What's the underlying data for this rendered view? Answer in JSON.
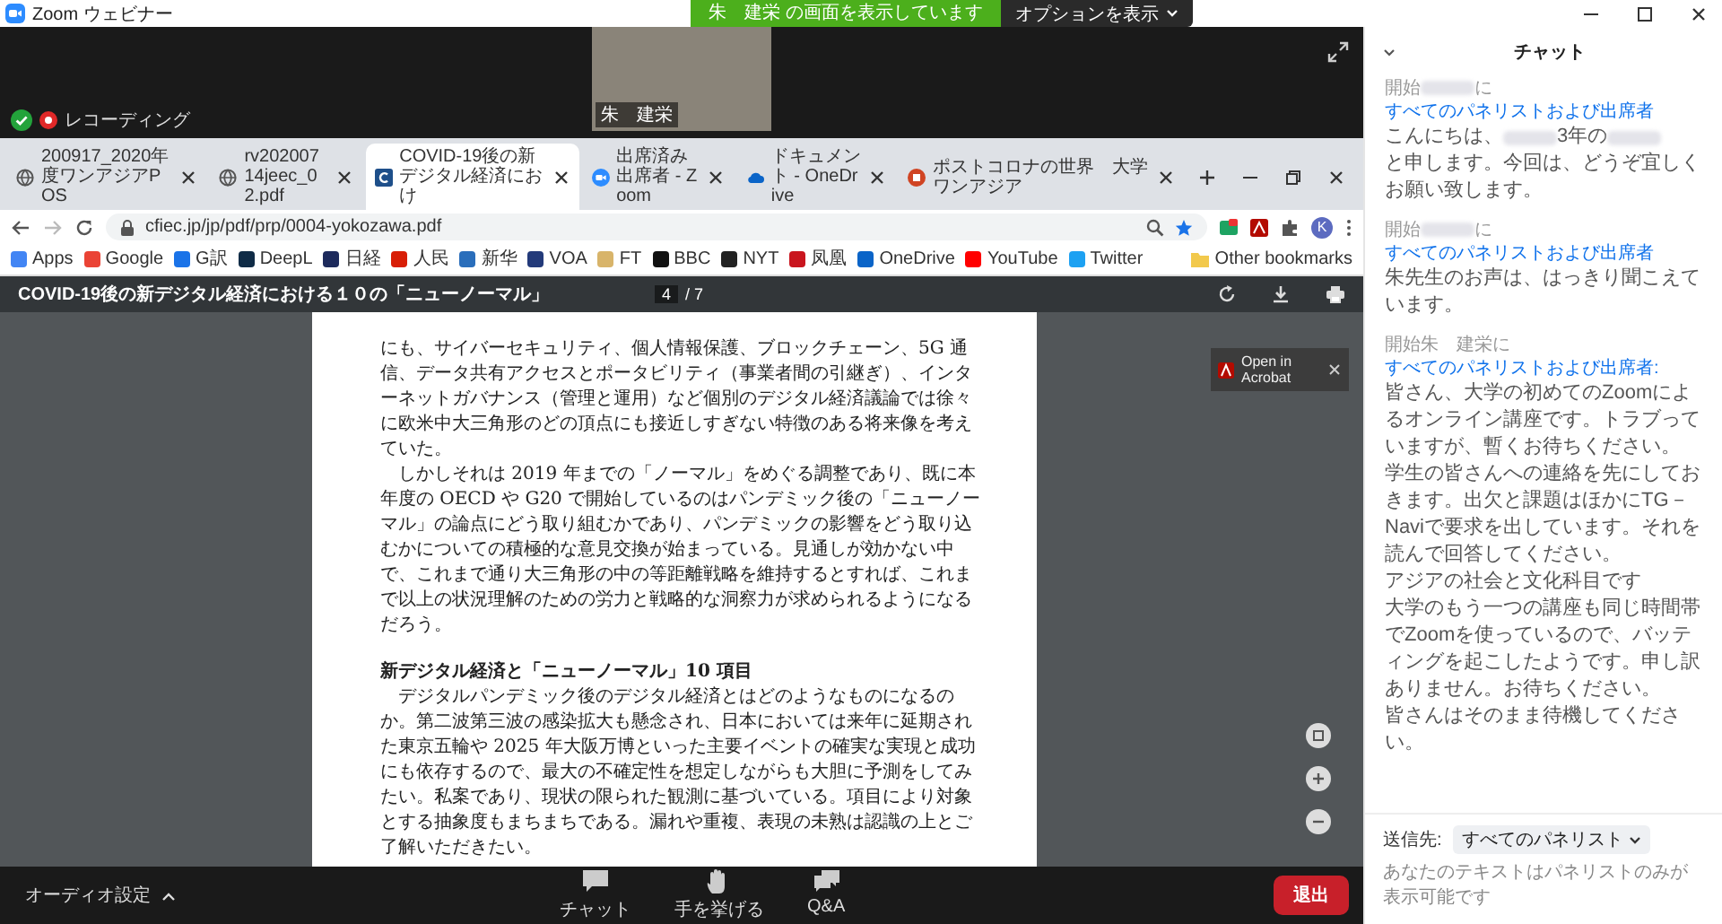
{
  "window": {
    "title": "Zoom ウェビナー"
  },
  "share_banner": {
    "status": "朱　建栄 の画面を表示しています",
    "options_button": "オプションを表示"
  },
  "video": {
    "name": "朱　建栄"
  },
  "recording": {
    "label": "レコーディング"
  },
  "browser": {
    "tabs": [
      {
        "title": "200917_2020年度ワンアジアPOS",
        "kind": "globe",
        "selected": false
      },
      {
        "title": "rv20200714jeec_02.pdf",
        "kind": "globe",
        "selected": false
      },
      {
        "title": "COVID-19後の新デジタル経済におけ",
        "kind": "doc",
        "selected": true
      },
      {
        "title": "出席済み出席者 - Zoom",
        "kind": "zoom",
        "selected": false
      },
      {
        "title": "ドキュメント - OneDrive",
        "kind": "cloud",
        "selected": false
      },
      {
        "title": "ポストコロナの世界　大学ワンアジア",
        "kind": "slides",
        "selected": false
      }
    ],
    "address": "cfiec.jp/jp/pdf/prp/0004-yokozawa.pdf",
    "profile_initial": "K",
    "bookmarks": [
      {
        "label": "Apps",
        "color": "#4285f4"
      },
      {
        "label": "Google",
        "color": "#ea4335"
      },
      {
        "label": "G訳",
        "color": "#1a73e8"
      },
      {
        "label": "DeepL",
        "color": "#0f2b46"
      },
      {
        "label": "日経",
        "color": "#1d2a5c"
      },
      {
        "label": "人民",
        "color": "#d81e06"
      },
      {
        "label": "新华",
        "color": "#2a6ebb"
      },
      {
        "label": "VOA",
        "color": "#233a7a"
      },
      {
        "label": "FT",
        "color": "#d8b46a"
      },
      {
        "label": "BBC",
        "color": "#111111"
      },
      {
        "label": "NYT",
        "color": "#222222"
      },
      {
        "label": "凤凰",
        "color": "#c9151e"
      },
      {
        "label": "OneDrive",
        "color": "#0a64c8"
      },
      {
        "label": "YouTube",
        "color": "#ff0000"
      },
      {
        "label": "Twitter",
        "color": "#1da1f2"
      }
    ],
    "other_bookmarks": "Other bookmarks"
  },
  "pdf": {
    "title": "COVID-19後の新デジタル経済における１０の「ニューノーマル」",
    "page": "4",
    "page_total": "/ 7",
    "paragraphs": [
      {
        "kind": "text",
        "indent": false,
        "text": "にも、サイバーセキュリティ、個人情報保護、ブロックチェーン、5G 通信、データ共有アクセスとポータビリティ（事業者間の引継ぎ）、インターネットガバナンス（管理と運用）など個別のデジタル経済議論では徐々に欧米中大三角形のどの頂点にも接近しすぎない特徴のある将来像を考えていた。"
      },
      {
        "kind": "text",
        "indent": true,
        "text": "しかしそれは 2019 年までの「ノーマル」をめぐる調整であり、既に本年度の OECD や G20 で開始しているのはパンデミック後の「ニューノーマル」の論点にどう取り組むかであり、パンデミックの影響をどう取り込むかについての積極的な意見交換が始まっている。見通しが効かない中で、これまで通り大三角形の中の等距離戦略を維持するとすれば、これまで以上の状況理解のための労力と戦略的な洞察力が求められるようになるだろう。"
      },
      {
        "kind": "heading",
        "indent": false,
        "text": "新デジタル経済と「ニューノーマル」10 項目"
      },
      {
        "kind": "text",
        "indent": true,
        "text": "デジタルパンデミック後のデジタル経済とはどのようなものになるのか。第二波第三波の感染拡大も懸念され、日本においては来年に延期された東京五輪や 2025 年大阪万博といった主要イベントの確実な実現と成功にも依存するので、最大の不確定性を想定しながらも大胆に予測をしてみたい。私案であり、現状の限られた観測に基づいている。項目により対象とする抽象度もまちまちである。漏れや重複、表現の未熟は認識の上とご了解いただきたい。"
      }
    ],
    "acrobat_tooltip": "Open in Acrobat"
  },
  "chat": {
    "title": "チャット",
    "messages": [
      {
        "header": [
          {
            "kind": "text",
            "text": "開始"
          },
          {
            "kind": "redacted"
          },
          {
            "kind": "text",
            "text": "に"
          }
        ],
        "to": "すべてのパネリストおよび出席者",
        "body": [
          [
            {
              "kind": "text",
              "text": "こんにちは、"
            },
            {
              "kind": "redacted"
            },
            {
              "kind": "text",
              "text": "3年の"
            },
            {
              "kind": "redacted"
            },
            {
              "kind": "text",
              "text": "と申します。今回は、どうぞ宜しくお願い致します。"
            }
          ]
        ]
      },
      {
        "header": [
          {
            "kind": "text",
            "text": "開始"
          },
          {
            "kind": "redacted"
          },
          {
            "kind": "text",
            "text": "に"
          }
        ],
        "to": "すべてのパネリストおよび出席者",
        "body": [
          [
            {
              "kind": "text",
              "text": "朱先生のお声は、はっきり聞こえています。"
            }
          ]
        ]
      },
      {
        "header": [
          {
            "kind": "text",
            "text": "開始朱　建栄に"
          }
        ],
        "to": "すべてのパネリストおよび出席者:",
        "body": [
          [
            {
              "kind": "text",
              "text": "皆さん、大学の初めてのZoomによるオンライン講座です。トラブっていますが、暫くお待ちください。"
            }
          ],
          [
            {
              "kind": "text",
              "text": "学生の皆さんへの連絡を先にしておきます。出欠と課題はほかにTG－Naviで要求を出しています。それを読んで回答してください。"
            }
          ],
          [
            {
              "kind": "text",
              "text": "アジアの社会と文化科目です"
            }
          ],
          [
            {
              "kind": "text",
              "text": "大学のもう一つの講座も同じ時間帯でZoomを使っているので、バッティングを起こしたようです。申し訳ありません。お待ちください。"
            }
          ],
          [
            {
              "kind": "text",
              "text": "皆さんはそのまま待機してください。"
            }
          ]
        ]
      }
    ],
    "send_to_label": "送信先:",
    "recipient": "すべてのパネリスト",
    "placeholder": "あなたのテキストはパネリストのみが表示可能です"
  },
  "toolbar": {
    "audio": "オーディオ設定",
    "buttons": [
      {
        "kind": "chat",
        "label": "チャット"
      },
      {
        "kind": "hand",
        "label": "手を挙げる"
      },
      {
        "kind": "qa",
        "label": "Q&A"
      }
    ],
    "leave": "退出"
  }
}
